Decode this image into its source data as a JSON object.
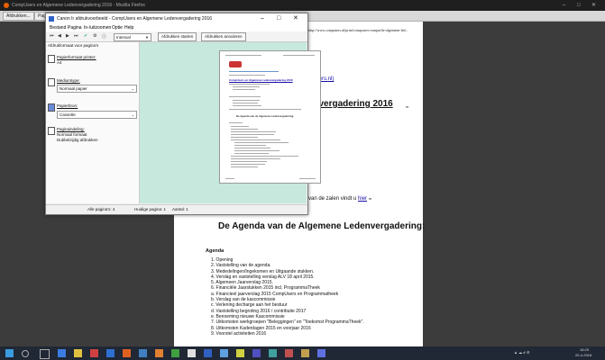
{
  "browser": {
    "title": "CompUsers en Algemene Ledenvergadering 2016 - Mozilla Firefox",
    "print_button": "Afdrukken...",
    "page_setup_button": "Pagina-instel",
    "url": "http://www.compusers.nl/print/composers-compufile-algemene-led..."
  },
  "page_fragments": {
    "link_fragment": "mpusers.nl)",
    "heading_fragment": "lenvergadering 2016",
    "heading_suffix": "m",
    "rooms_text": "van de zalen vindt u",
    "rooms_link": "hier",
    "rooms_suffix": "m",
    "big_heading": "De Agenda van de Algemene Ledenvergadering:",
    "agenda_title": "Agenda",
    "agenda_items": [
      "1. Opening",
      "2. Vaststelling van de agenda.",
      "3. Mededelingen/Ingekomen en Uitgaande stukken.",
      "4. Verslag en vaststelling verslag ALV 18 april 2015.",
      "5. Algemeen Jaarverslag 2015.",
      "6. Financiële Jaarstukken 2015 incl. ProgrammaTheek",
      "     a. Financieel jaarverslag 2015 CompUsers en Programmatheek",
      "     b. Verslag van de kascommissie",
      "     c. Verlening decharge aan het bestuur",
      "     d. Vaststelling begroting 2016 / contributie 2017",
      "     e. Benoeming nieuwe Kascommissie",
      "7. Uitkomsten werkgroepen \"Beleggingen\" en \"Toekomst ProgrammaTheek\".",
      "8. Uitkomsten Kaderdagen 2015 en voorjaar 2016",
      "9. Voorstel activiteiten 2016"
    ]
  },
  "dialog": {
    "title": "Canon Ir afdrukvoorbeeld - CompUsers en Algemene Ledenvergadering 2016",
    "menu": [
      "Bestand",
      "Pagina",
      "In-/uitzoomen",
      "Optie",
      "Help"
    ],
    "zoom_select": "Intensal",
    "print_start": "Afdrukken starten",
    "print_cancel": "Afdrukken annuleren",
    "left_header": "Afdrukformaat voor pagina's",
    "sections": [
      {
        "label": "Papierformaat printer:",
        "value": "A4"
      },
      {
        "label": "Mediumtype:",
        "value": "Normaal papier"
      },
      {
        "label": "Papierbron:",
        "value": "Cassette"
      },
      {
        "label": "Paginaindeling:",
        "value": "Normaal formaat",
        "extra": "Dubbelzijdig afdrukken"
      }
    ],
    "status": {
      "all_pages": "Alle pagina's: 4",
      "current_page": "Huidige pagina: 1",
      "count": "Aantal: 1"
    },
    "preview": {
      "heading": "CompUsers en Algemene Ledenvergadering 2016",
      "agenda_heading": "De Agenda van de Algemene Ledenvergadering:"
    }
  },
  "taskbar": {
    "clock_time": "18:29",
    "clock_date": "20-4-2016"
  },
  "colors": {
    "preview_bg": "#c6e8dd",
    "taskbar": "#202735",
    "link": "#1a0dab"
  }
}
